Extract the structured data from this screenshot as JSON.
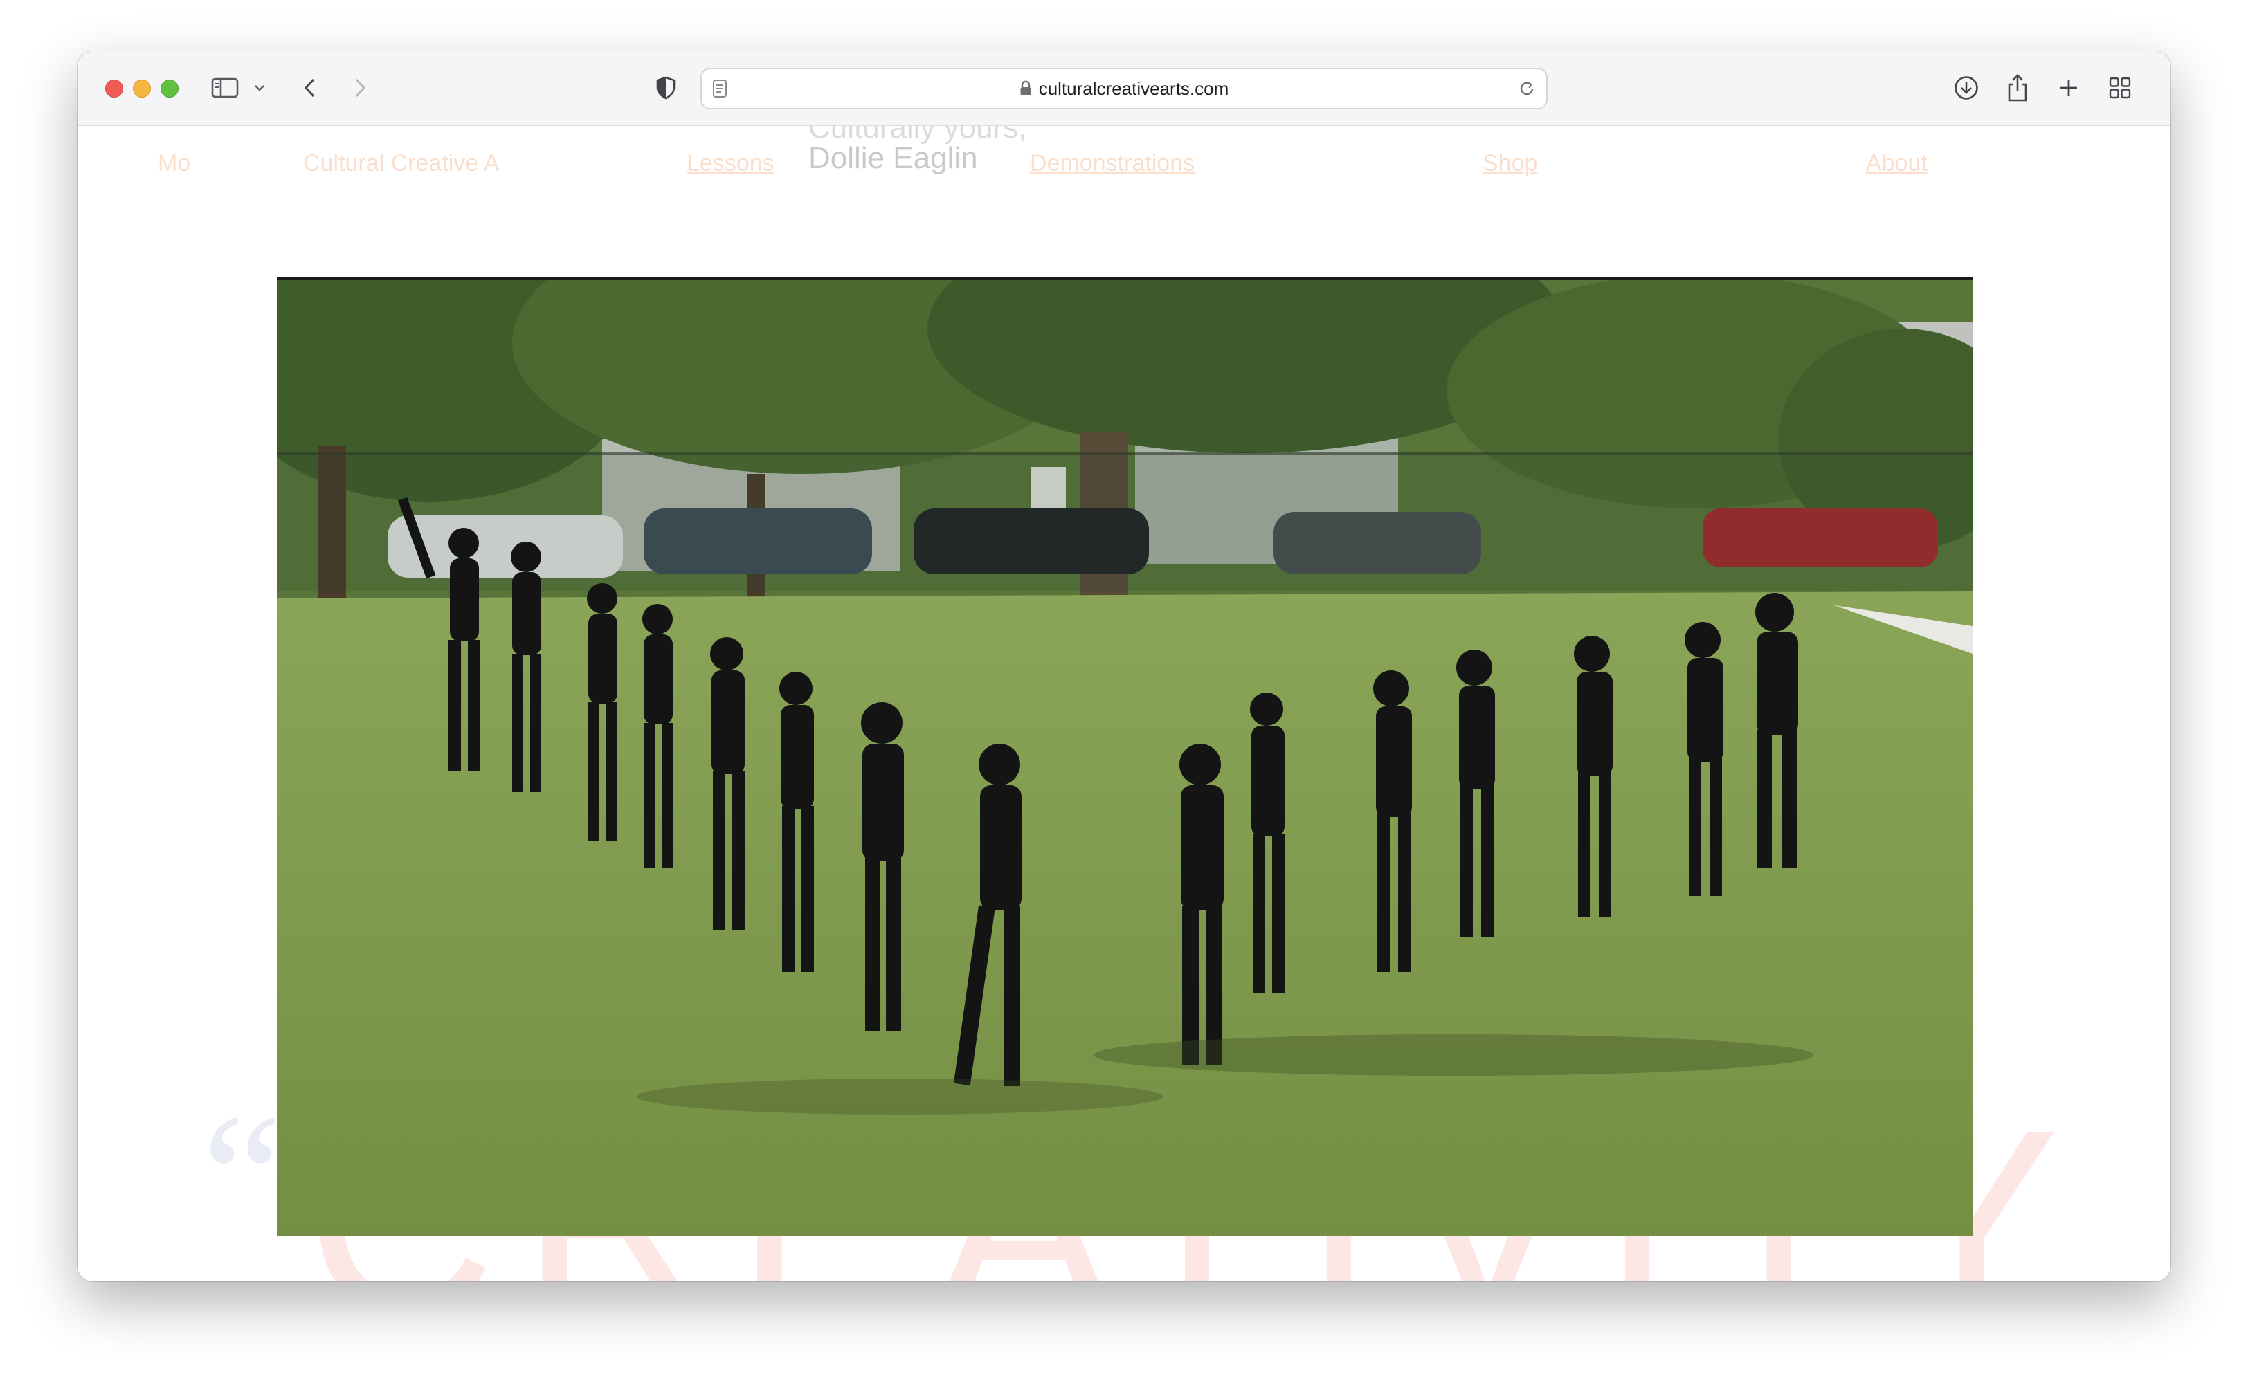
{
  "browser": {
    "url": "culturalcreativearts.com"
  },
  "site": {
    "nav": {
      "left_item": "Mo",
      "brand": "Cultural Creative A",
      "lessons": "Lessons",
      "demonstrations": "Demonstrations",
      "shop": "Shop",
      "about": "About"
    },
    "greeting_line_1": "Culturally yours,",
    "greeting_line_2": "Dollie Eaglin",
    "background_word": "CREATIVITY"
  },
  "colors": {
    "accent": "#f6c6a6",
    "grass": "#7e9a4c",
    "tree": "#3d5a2a"
  }
}
